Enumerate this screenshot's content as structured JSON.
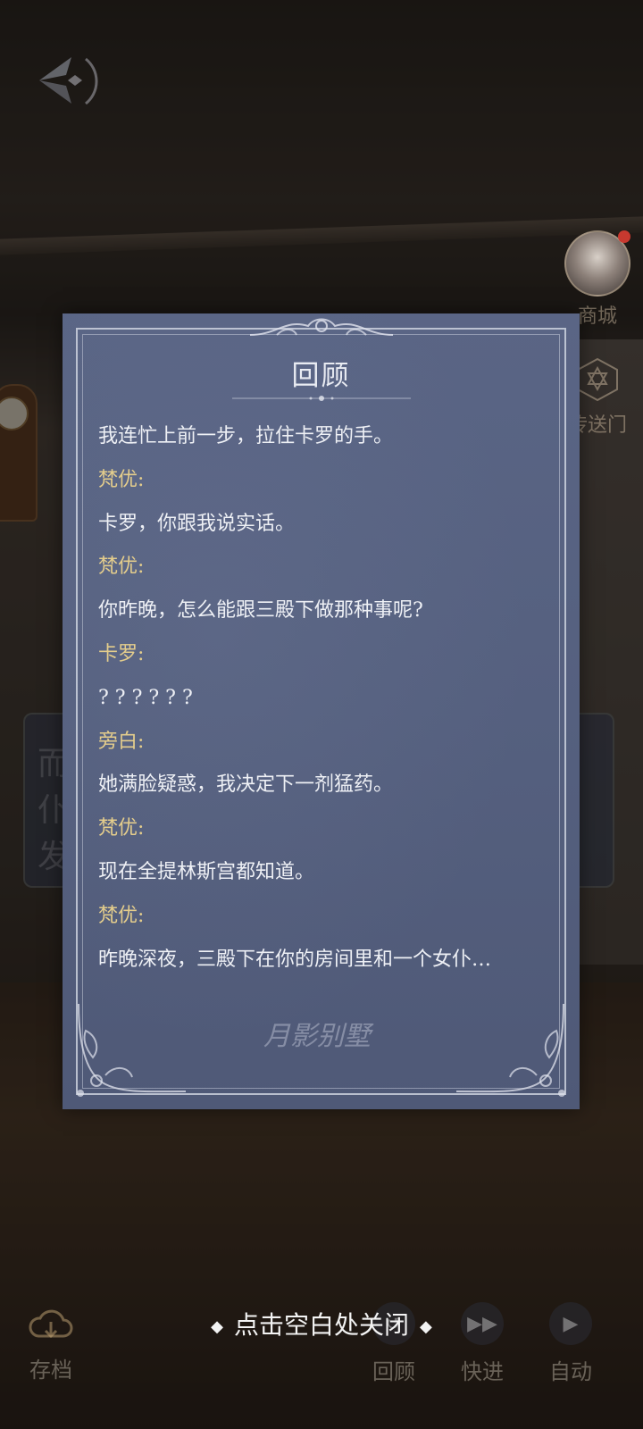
{
  "background": {
    "side_menu": {
      "shop_label": "商城",
      "portal_label": "传送门"
    },
    "dialog_ghost_lines": [
      "而……",
      "仆……",
      "发……"
    ],
    "bottom_controls": {
      "save_label": "存档",
      "review_label": "回顾",
      "fastforward_label": "快进",
      "auto_label": "自动"
    }
  },
  "review": {
    "title": "回顾",
    "lines": [
      {
        "type": "text",
        "text": "我连忙上前一步，拉住卡罗的手。"
      },
      {
        "type": "speaker",
        "text": "梵优:"
      },
      {
        "type": "text",
        "text": "卡罗，你跟我说实话。"
      },
      {
        "type": "speaker",
        "text": "梵优:"
      },
      {
        "type": "text",
        "text": "你昨晚，怎么能跟三殿下做那种事呢?"
      },
      {
        "type": "speaker",
        "text": "卡罗:"
      },
      {
        "type": "text",
        "text": "? ? ? ? ? ?"
      },
      {
        "type": "speaker",
        "text": "旁白:"
      },
      {
        "type": "text",
        "text": "她满脸疑惑，我决定下一剂猛药。"
      },
      {
        "type": "speaker",
        "text": "梵优:"
      },
      {
        "type": "text",
        "text": "现在全提林斯宫都知道。"
      },
      {
        "type": "speaker",
        "text": "梵优:"
      },
      {
        "type": "text",
        "text": "昨晚深夜，三殿下在你的房间里和一个女仆…"
      }
    ],
    "logo_text": "月影别墅"
  },
  "close_hint": "点击空白处关闭",
  "colors": {
    "panel_bg": "#55607f",
    "speaker_color": "#e4cd8c",
    "text_color": "#eef0f5"
  }
}
